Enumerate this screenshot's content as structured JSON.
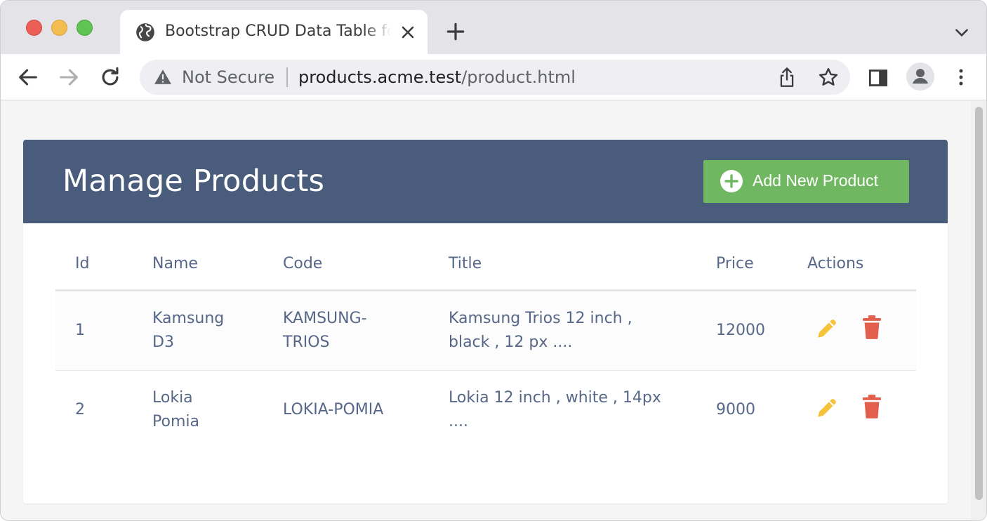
{
  "browser": {
    "tab_title": "Bootstrap CRUD Data Table for",
    "security_label": "Not Secure",
    "url_host": "products.acme.test",
    "url_path": "/product.html"
  },
  "page": {
    "title": "Manage Products",
    "add_button_label": "Add New Product"
  },
  "table": {
    "headers": {
      "id": "Id",
      "name": "Name",
      "code": "Code",
      "title": "Title",
      "price": "Price",
      "actions": "Actions"
    },
    "rows": [
      {
        "id": "1",
        "name_line1": "Kamsung",
        "name_line2": "D3",
        "code_line1": "KAMSUNG-",
        "code_line2": "TRIOS",
        "title_line1": "Kamsung Trios 12 inch ,",
        "title_line2": "black , 12 px ....",
        "price": "12000"
      },
      {
        "id": "2",
        "name_line1": "Lokia",
        "name_line2": "Pomia",
        "code": "LOKIA-POMIA",
        "title_line1": "Lokia 12 inch , white , 14px",
        "title_line2": "....",
        "price": "9000"
      }
    ]
  },
  "colors": {
    "header_bg": "#495c7c",
    "add_button_bg": "#70b761",
    "edit_icon": "#f5c33b",
    "delete_icon": "#e35f4d",
    "text": "#566787"
  },
  "icons": {
    "tab": "globe-icon",
    "add": "plus-circle-icon",
    "edit": "pencil-icon",
    "delete": "trash-icon"
  }
}
